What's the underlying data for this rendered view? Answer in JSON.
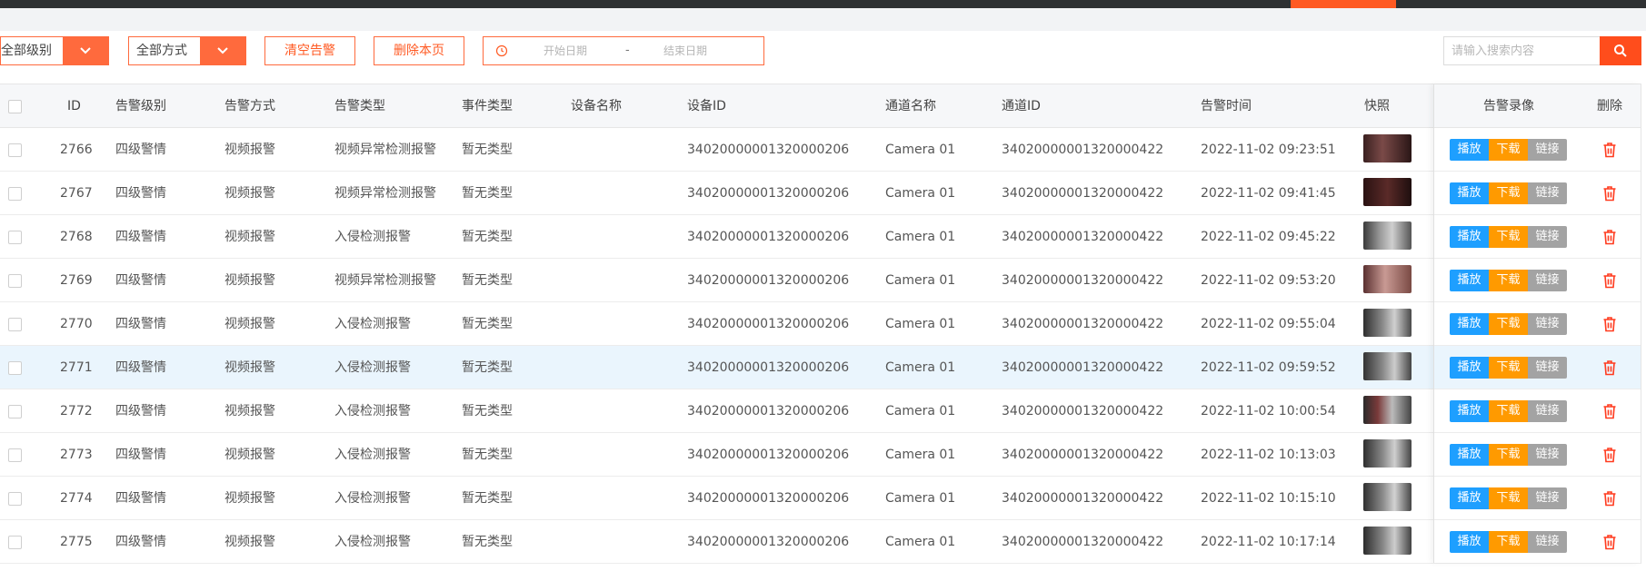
{
  "toolbar": {
    "level_select": "全部级别",
    "method_select": "全部方式",
    "clear_button": "清空告警",
    "delete_page_button": "删除本页",
    "date_start_placeholder": "开始日期",
    "date_separator": "-",
    "date_end_placeholder": "结束日期",
    "search_placeholder": "请输入搜索内容"
  },
  "colors": {
    "accent": "#ff5a23",
    "play": "#1e9fff",
    "download": "#ff9a00",
    "link": "#a3a3a3",
    "delete": "#ff3b1f"
  },
  "table": {
    "headers": {
      "id": "ID",
      "level": "告警级别",
      "method": "告警方式",
      "alarm_type": "告警类型",
      "event_type": "事件类型",
      "device_name": "设备名称",
      "device_id": "设备ID",
      "channel_name": "通道名称",
      "channel_id": "通道ID",
      "alarm_time": "告警时间",
      "snapshot": "快照",
      "recording": "告警录像",
      "delete": "删除"
    },
    "actions": {
      "play": "播放",
      "download": "下载",
      "link": "链接"
    },
    "rows": [
      {
        "id": "2766",
        "level": "四级警情",
        "method": "视频报警",
        "alarm_type": "视频异常检测报警",
        "event_type": "暂无类型",
        "device_name": "",
        "device_id": "34020000001320000206",
        "channel_name": "Camera 01",
        "channel_id": "34020000001320000422",
        "time": "2022-11-02 09:23:51"
      },
      {
        "id": "2767",
        "level": "四级警情",
        "method": "视频报警",
        "alarm_type": "视频异常检测报警",
        "event_type": "暂无类型",
        "device_name": "",
        "device_id": "34020000001320000206",
        "channel_name": "Camera 01",
        "channel_id": "34020000001320000422",
        "time": "2022-11-02 09:41:45"
      },
      {
        "id": "2768",
        "level": "四级警情",
        "method": "视频报警",
        "alarm_type": "入侵检测报警",
        "event_type": "暂无类型",
        "device_name": "",
        "device_id": "34020000001320000206",
        "channel_name": "Camera 01",
        "channel_id": "34020000001320000422",
        "time": "2022-11-02 09:45:22"
      },
      {
        "id": "2769",
        "level": "四级警情",
        "method": "视频报警",
        "alarm_type": "视频异常检测报警",
        "event_type": "暂无类型",
        "device_name": "",
        "device_id": "34020000001320000206",
        "channel_name": "Camera 01",
        "channel_id": "34020000001320000422",
        "time": "2022-11-02 09:53:20"
      },
      {
        "id": "2770",
        "level": "四级警情",
        "method": "视频报警",
        "alarm_type": "入侵检测报警",
        "event_type": "暂无类型",
        "device_name": "",
        "device_id": "34020000001320000206",
        "channel_name": "Camera 01",
        "channel_id": "34020000001320000422",
        "time": "2022-11-02 09:55:04"
      },
      {
        "id": "2771",
        "level": "四级警情",
        "method": "视频报警",
        "alarm_type": "入侵检测报警",
        "event_type": "暂无类型",
        "device_name": "",
        "device_id": "34020000001320000206",
        "channel_name": "Camera 01",
        "channel_id": "34020000001320000422",
        "time": "2022-11-02 09:59:52"
      },
      {
        "id": "2772",
        "level": "四级警情",
        "method": "视频报警",
        "alarm_type": "入侵检测报警",
        "event_type": "暂无类型",
        "device_name": "",
        "device_id": "34020000001320000206",
        "channel_name": "Camera 01",
        "channel_id": "34020000001320000422",
        "time": "2022-11-02 10:00:54"
      },
      {
        "id": "2773",
        "level": "四级警情",
        "method": "视频报警",
        "alarm_type": "入侵检测报警",
        "event_type": "暂无类型",
        "device_name": "",
        "device_id": "34020000001320000206",
        "channel_name": "Camera 01",
        "channel_id": "34020000001320000422",
        "time": "2022-11-02 10:13:03"
      },
      {
        "id": "2774",
        "level": "四级警情",
        "method": "视频报警",
        "alarm_type": "入侵检测报警",
        "event_type": "暂无类型",
        "device_name": "",
        "device_id": "34020000001320000206",
        "channel_name": "Camera 01",
        "channel_id": "34020000001320000422",
        "time": "2022-11-02 10:15:10"
      },
      {
        "id": "2775",
        "level": "四级警情",
        "method": "视频报警",
        "alarm_type": "入侵检测报警",
        "event_type": "暂无类型",
        "device_name": "",
        "device_id": "34020000001320000206",
        "channel_name": "Camera 01",
        "channel_id": "34020000001320000422",
        "time": "2022-11-02 10:17:14"
      }
    ]
  }
}
